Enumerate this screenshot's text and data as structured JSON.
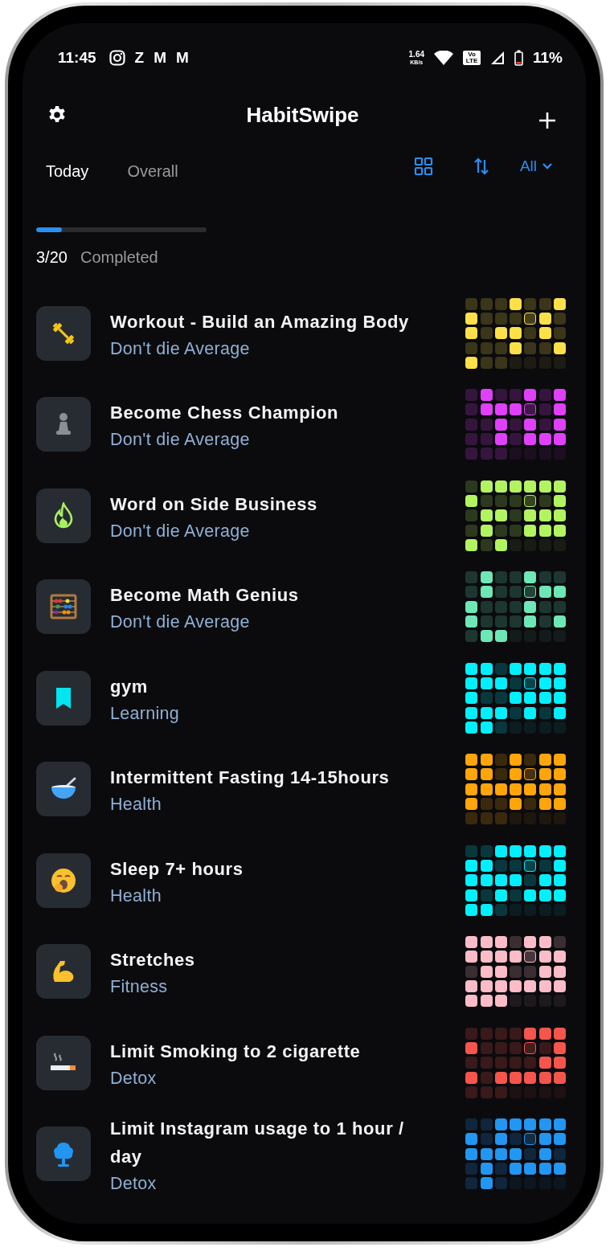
{
  "status_bar": {
    "time": "11:45",
    "notification_apps": [
      "Z",
      "M",
      "M"
    ],
    "speed": "1.64",
    "speed_unit": "KB/s",
    "volte": "Vo LTE",
    "battery": "11%"
  },
  "header": {
    "title": "HabitSwipe"
  },
  "tabs": [
    {
      "label": "Today",
      "selected": true
    },
    {
      "label": "Overall",
      "selected": false
    }
  ],
  "filter": {
    "label": "All"
  },
  "progress": {
    "level": 0.15,
    "count": "3/20",
    "label": "Completed"
  },
  "habits": [
    {
      "title": "Workout - Build an Amazing Body",
      "category": "Don't die Average",
      "kind": "dumbbell",
      "color": "#fde047",
      "days": [
        {
          "kind": "missed"
        },
        {
          "kind": "missed"
        },
        {
          "kind": "missed"
        },
        {
          "kind": "done"
        },
        {
          "kind": "missed"
        },
        {
          "kind": "missed"
        },
        {
          "kind": "done"
        },
        {
          "kind": "done"
        },
        {
          "kind": "missed"
        },
        {
          "kind": "missed"
        },
        {
          "kind": "missed"
        },
        {
          "kind": "today"
        },
        {
          "kind": "done"
        },
        {
          "kind": "missed"
        },
        {
          "kind": "done"
        },
        {
          "kind": "missed"
        },
        {
          "kind": "done"
        },
        {
          "kind": "done"
        },
        {
          "kind": "missed"
        },
        {
          "kind": "done"
        },
        {
          "kind": "missed"
        },
        {
          "kind": "missed"
        },
        {
          "kind": "missed"
        },
        {
          "kind": "missed"
        },
        {
          "kind": "done"
        },
        {
          "kind": "missed"
        },
        {
          "kind": "missed"
        },
        {
          "kind": "done"
        },
        {
          "kind": "done"
        },
        {
          "kind": "missed"
        },
        {
          "kind": "missed"
        },
        {
          "kind": "upcoming"
        },
        {
          "kind": "upcoming"
        },
        {
          "kind": "upcoming"
        },
        {
          "kind": "upcoming"
        }
      ]
    },
    {
      "title": "Become Chess Champion",
      "category": "Don't die Average",
      "kind": "pawn",
      "color": "#e040fb",
      "days": [
        {
          "kind": "missed"
        },
        {
          "kind": "done"
        },
        {
          "kind": "missed"
        },
        {
          "kind": "missed"
        },
        {
          "kind": "done"
        },
        {
          "kind": "missed"
        },
        {
          "kind": "done"
        },
        {
          "kind": "missed"
        },
        {
          "kind": "done"
        },
        {
          "kind": "done"
        },
        {
          "kind": "done"
        },
        {
          "kind": "today"
        },
        {
          "kind": "missed"
        },
        {
          "kind": "done"
        },
        {
          "kind": "missed"
        },
        {
          "kind": "missed"
        },
        {
          "kind": "done"
        },
        {
          "kind": "missed"
        },
        {
          "kind": "done"
        },
        {
          "kind": "missed"
        },
        {
          "kind": "done"
        },
        {
          "kind": "missed"
        },
        {
          "kind": "missed"
        },
        {
          "kind": "done"
        },
        {
          "kind": "missed"
        },
        {
          "kind": "done"
        },
        {
          "kind": "done"
        },
        {
          "kind": "done"
        },
        {
          "kind": "missed"
        },
        {
          "kind": "missed"
        },
        {
          "kind": "missed"
        },
        {
          "kind": "upcoming"
        },
        {
          "kind": "upcoming"
        },
        {
          "kind": "upcoming"
        },
        {
          "kind": "upcoming"
        }
      ]
    },
    {
      "title": "Word on Side Business",
      "category": "Don't die Average",
      "kind": "flame",
      "color": "#b2f45f",
      "days": [
        {
          "kind": "missed"
        },
        {
          "kind": "done"
        },
        {
          "kind": "done"
        },
        {
          "kind": "done"
        },
        {
          "kind": "done"
        },
        {
          "kind": "done"
        },
        {
          "kind": "done"
        },
        {
          "kind": "done"
        },
        {
          "kind": "missed"
        },
        {
          "kind": "missed"
        },
        {
          "kind": "missed"
        },
        {
          "kind": "today"
        },
        {
          "kind": "missed"
        },
        {
          "kind": "done"
        },
        {
          "kind": "missed"
        },
        {
          "kind": "done"
        },
        {
          "kind": "done"
        },
        {
          "kind": "missed"
        },
        {
          "kind": "done"
        },
        {
          "kind": "done"
        },
        {
          "kind": "done"
        },
        {
          "kind": "missed"
        },
        {
          "kind": "done"
        },
        {
          "kind": "missed"
        },
        {
          "kind": "missed"
        },
        {
          "kind": "done"
        },
        {
          "kind": "done"
        },
        {
          "kind": "done"
        },
        {
          "kind": "done"
        },
        {
          "kind": "missed"
        },
        {
          "kind": "done"
        },
        {
          "kind": "upcoming"
        },
        {
          "kind": "upcoming"
        },
        {
          "kind": "upcoming"
        },
        {
          "kind": "upcoming"
        }
      ]
    },
    {
      "title": "Become Math Genius",
      "category": "Don't die Average",
      "kind": "abacus",
      "color": "#6ee7b7",
      "days": [
        {
          "kind": "missed"
        },
        {
          "kind": "done"
        },
        {
          "kind": "missed"
        },
        {
          "kind": "missed"
        },
        {
          "kind": "done"
        },
        {
          "kind": "missed"
        },
        {
          "kind": "missed"
        },
        {
          "kind": "missed"
        },
        {
          "kind": "done"
        },
        {
          "kind": "missed"
        },
        {
          "kind": "missed"
        },
        {
          "kind": "today"
        },
        {
          "kind": "done"
        },
        {
          "kind": "done"
        },
        {
          "kind": "done"
        },
        {
          "kind": "missed"
        },
        {
          "kind": "missed"
        },
        {
          "kind": "missed"
        },
        {
          "kind": "done"
        },
        {
          "kind": "missed"
        },
        {
          "kind": "missed"
        },
        {
          "kind": "done"
        },
        {
          "kind": "missed"
        },
        {
          "kind": "missed"
        },
        {
          "kind": "missed"
        },
        {
          "kind": "done"
        },
        {
          "kind": "missed"
        },
        {
          "kind": "done"
        },
        {
          "kind": "missed"
        },
        {
          "kind": "done"
        },
        {
          "kind": "done"
        },
        {
          "kind": "upcoming"
        },
        {
          "kind": "upcoming"
        },
        {
          "kind": "upcoming"
        },
        {
          "kind": "upcoming"
        }
      ]
    },
    {
      "title": "gym",
      "category": "Learning",
      "kind": "bookmark",
      "color": "#00f0ff",
      "days": [
        {
          "kind": "done"
        },
        {
          "kind": "done"
        },
        {
          "kind": "missed"
        },
        {
          "kind": "done"
        },
        {
          "kind": "done"
        },
        {
          "kind": "done"
        },
        {
          "kind": "done"
        },
        {
          "kind": "done"
        },
        {
          "kind": "done"
        },
        {
          "kind": "done"
        },
        {
          "kind": "missed"
        },
        {
          "kind": "today"
        },
        {
          "kind": "done"
        },
        {
          "kind": "done"
        },
        {
          "kind": "done"
        },
        {
          "kind": "missed"
        },
        {
          "kind": "missed"
        },
        {
          "kind": "done"
        },
        {
          "kind": "done"
        },
        {
          "kind": "done"
        },
        {
          "kind": "done"
        },
        {
          "kind": "done"
        },
        {
          "kind": "done"
        },
        {
          "kind": "done"
        },
        {
          "kind": "missed"
        },
        {
          "kind": "done"
        },
        {
          "kind": "missed"
        },
        {
          "kind": "done"
        },
        {
          "kind": "done"
        },
        {
          "kind": "done"
        },
        {
          "kind": "missed"
        },
        {
          "kind": "upcoming"
        },
        {
          "kind": "upcoming"
        },
        {
          "kind": "upcoming"
        },
        {
          "kind": "upcoming"
        }
      ]
    },
    {
      "title": "Intermittent Fasting 14-15hours",
      "category": "Health",
      "kind": "bowl",
      "color": "#ffa50a",
      "days": [
        {
          "kind": "done"
        },
        {
          "kind": "done"
        },
        {
          "kind": "missed"
        },
        {
          "kind": "done"
        },
        {
          "kind": "missed"
        },
        {
          "kind": "done"
        },
        {
          "kind": "done"
        },
        {
          "kind": "done"
        },
        {
          "kind": "done"
        },
        {
          "kind": "missed"
        },
        {
          "kind": "done"
        },
        {
          "kind": "today"
        },
        {
          "kind": "done"
        },
        {
          "kind": "done"
        },
        {
          "kind": "done"
        },
        {
          "kind": "done"
        },
        {
          "kind": "done"
        },
        {
          "kind": "done"
        },
        {
          "kind": "done"
        },
        {
          "kind": "done"
        },
        {
          "kind": "done"
        },
        {
          "kind": "done"
        },
        {
          "kind": "missed"
        },
        {
          "kind": "missed"
        },
        {
          "kind": "done"
        },
        {
          "kind": "missed"
        },
        {
          "kind": "done"
        },
        {
          "kind": "done"
        },
        {
          "kind": "missed"
        },
        {
          "kind": "missed"
        },
        {
          "kind": "missed"
        },
        {
          "kind": "upcoming"
        },
        {
          "kind": "upcoming"
        },
        {
          "kind": "upcoming"
        },
        {
          "kind": "upcoming"
        }
      ]
    },
    {
      "title": "Sleep 7+ hours",
      "category": "Health",
      "kind": "yawn",
      "color": "#00f0ff",
      "days": [
        {
          "kind": "missed"
        },
        {
          "kind": "missed"
        },
        {
          "kind": "done"
        },
        {
          "kind": "done"
        },
        {
          "kind": "done"
        },
        {
          "kind": "done"
        },
        {
          "kind": "done"
        },
        {
          "kind": "done"
        },
        {
          "kind": "done"
        },
        {
          "kind": "missed"
        },
        {
          "kind": "missed"
        },
        {
          "kind": "today"
        },
        {
          "kind": "missed"
        },
        {
          "kind": "done"
        },
        {
          "kind": "done"
        },
        {
          "kind": "done"
        },
        {
          "kind": "done"
        },
        {
          "kind": "done"
        },
        {
          "kind": "missed"
        },
        {
          "kind": "done"
        },
        {
          "kind": "done"
        },
        {
          "kind": "done"
        },
        {
          "kind": "missed"
        },
        {
          "kind": "done"
        },
        {
          "kind": "missed"
        },
        {
          "kind": "done"
        },
        {
          "kind": "done"
        },
        {
          "kind": "done"
        },
        {
          "kind": "done"
        },
        {
          "kind": "done"
        },
        {
          "kind": "missed"
        },
        {
          "kind": "upcoming"
        },
        {
          "kind": "upcoming"
        },
        {
          "kind": "upcoming"
        },
        {
          "kind": "upcoming"
        }
      ]
    },
    {
      "title": "Stretches",
      "category": "Fitness",
      "kind": "arm",
      "color": "#fbbcc8",
      "days": [
        {
          "kind": "done"
        },
        {
          "kind": "done"
        },
        {
          "kind": "done"
        },
        {
          "kind": "missed"
        },
        {
          "kind": "done"
        },
        {
          "kind": "done"
        },
        {
          "kind": "missed"
        },
        {
          "kind": "done"
        },
        {
          "kind": "done"
        },
        {
          "kind": "done"
        },
        {
          "kind": "done"
        },
        {
          "kind": "today"
        },
        {
          "kind": "done"
        },
        {
          "kind": "done"
        },
        {
          "kind": "missed"
        },
        {
          "kind": "done"
        },
        {
          "kind": "done"
        },
        {
          "kind": "missed"
        },
        {
          "kind": "missed"
        },
        {
          "kind": "done"
        },
        {
          "kind": "done"
        },
        {
          "kind": "done"
        },
        {
          "kind": "done"
        },
        {
          "kind": "done"
        },
        {
          "kind": "done"
        },
        {
          "kind": "done"
        },
        {
          "kind": "done"
        },
        {
          "kind": "done"
        },
        {
          "kind": "done"
        },
        {
          "kind": "done"
        },
        {
          "kind": "done"
        },
        {
          "kind": "upcoming"
        },
        {
          "kind": "upcoming"
        },
        {
          "kind": "upcoming"
        },
        {
          "kind": "upcoming"
        }
      ]
    },
    {
      "title": "Limit Smoking to 2 cigarette",
      "category": "Detox",
      "kind": "cigarette",
      "color": "#f5554c",
      "days": [
        {
          "kind": "missed"
        },
        {
          "kind": "missed"
        },
        {
          "kind": "missed"
        },
        {
          "kind": "missed"
        },
        {
          "kind": "done"
        },
        {
          "kind": "done"
        },
        {
          "kind": "done"
        },
        {
          "kind": "done"
        },
        {
          "kind": "missed"
        },
        {
          "kind": "missed"
        },
        {
          "kind": "missed"
        },
        {
          "kind": "today"
        },
        {
          "kind": "missed"
        },
        {
          "kind": "done"
        },
        {
          "kind": "missed"
        },
        {
          "kind": "missed"
        },
        {
          "kind": "missed"
        },
        {
          "kind": "missed"
        },
        {
          "kind": "missed"
        },
        {
          "kind": "done"
        },
        {
          "kind": "done"
        },
        {
          "kind": "done"
        },
        {
          "kind": "missed"
        },
        {
          "kind": "done"
        },
        {
          "kind": "done"
        },
        {
          "kind": "done"
        },
        {
          "kind": "done"
        },
        {
          "kind": "done"
        },
        {
          "kind": "missed"
        },
        {
          "kind": "missed"
        },
        {
          "kind": "missed"
        },
        {
          "kind": "upcoming"
        },
        {
          "kind": "upcoming"
        },
        {
          "kind": "upcoming"
        },
        {
          "kind": "upcoming"
        }
      ]
    },
    {
      "title": "Limit Instagram usage to 1 hour / day",
      "category": "Detox",
      "kind": "tree",
      "color": "#2196f3",
      "days": [
        {
          "kind": "missed"
        },
        {
          "kind": "missed"
        },
        {
          "kind": "done"
        },
        {
          "kind": "done"
        },
        {
          "kind": "done"
        },
        {
          "kind": "done"
        },
        {
          "kind": "done"
        },
        {
          "kind": "done"
        },
        {
          "kind": "missed"
        },
        {
          "kind": "done"
        },
        {
          "kind": "missed"
        },
        {
          "kind": "today"
        },
        {
          "kind": "done"
        },
        {
          "kind": "done"
        },
        {
          "kind": "done"
        },
        {
          "kind": "done"
        },
        {
          "kind": "done"
        },
        {
          "kind": "done"
        },
        {
          "kind": "missed"
        },
        {
          "kind": "done"
        },
        {
          "kind": "missed"
        },
        {
          "kind": "missed"
        },
        {
          "kind": "done"
        },
        {
          "kind": "missed"
        },
        {
          "kind": "done"
        },
        {
          "kind": "done"
        },
        {
          "kind": "done"
        },
        {
          "kind": "done"
        },
        {
          "kind": "missed"
        },
        {
          "kind": "done"
        },
        {
          "kind": "missed"
        },
        {
          "kind": "upcoming"
        },
        {
          "kind": "upcoming"
        },
        {
          "kind": "upcoming"
        },
        {
          "kind": "upcoming"
        }
      ]
    }
  ]
}
